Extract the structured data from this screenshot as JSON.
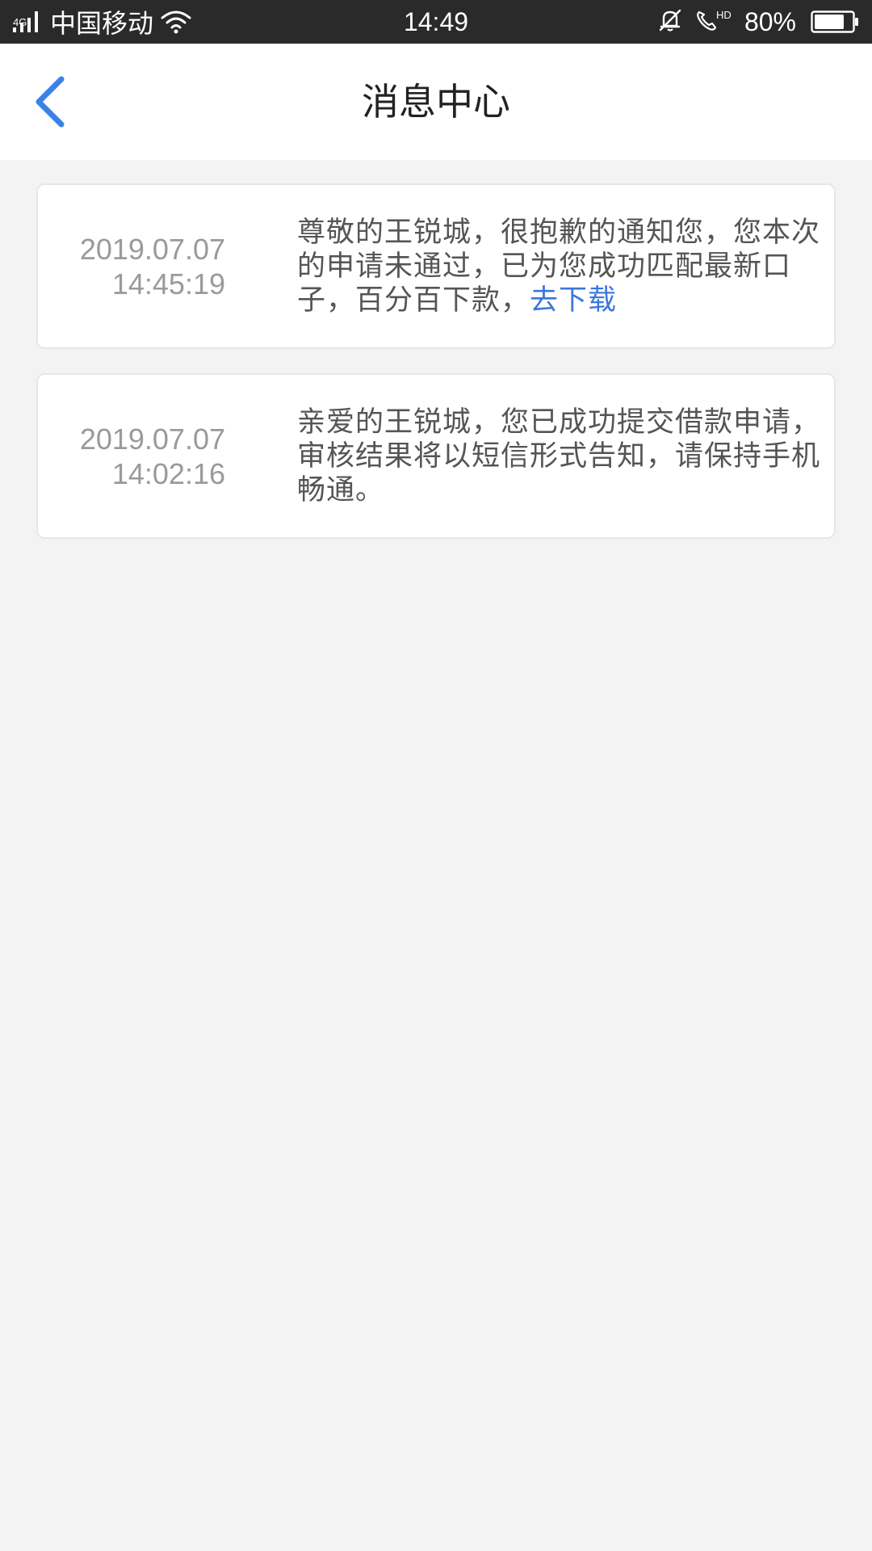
{
  "status_bar": {
    "network_type": "4G",
    "carrier": "中国移动",
    "time": "14:49",
    "battery_percent": "80%",
    "battery_level": 0.8,
    "icons": [
      "signal-icon",
      "wifi-icon",
      "bell-muted-icon",
      "hd-call-icon",
      "battery-icon"
    ]
  },
  "header": {
    "title": "消息中心",
    "back_icon": "chevron-left-icon",
    "accent_color": "#3b82e6"
  },
  "messages": [
    {
      "date": "2019.07.07",
      "time": "14:45:19",
      "text": "尊敬的王锐城，很抱歉的通知您，您本次的申请未通过，已为您成功匹配最新口子，百分百下款，",
      "link_label": "去下载"
    },
    {
      "date": "2019.07.07",
      "time": "14:02:16",
      "text": "亲爱的王锐城，您已成功提交借款申请，审核结果将以短信形式告知，请保持手机畅通。"
    }
  ],
  "colors": {
    "background": "#f3f3f3",
    "status_bar": "#2a2a2a",
    "link": "#3b76dd",
    "timestamp": "#9a9a9a",
    "body_text": "#555555"
  }
}
